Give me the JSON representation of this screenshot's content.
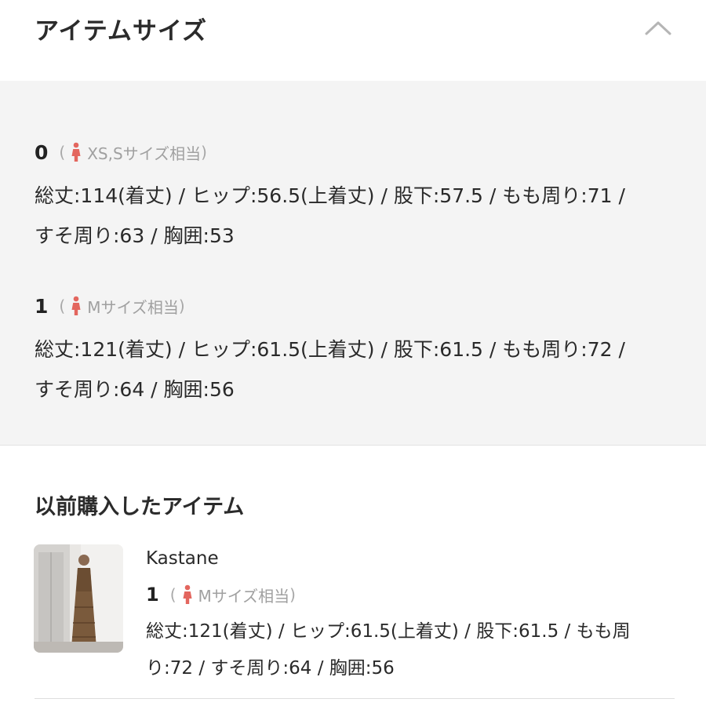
{
  "header": {
    "title": "アイテムサイズ",
    "toggle_icon": "chevron-up-icon"
  },
  "sizes": [
    {
      "number": "0",
      "paren_open": "(",
      "equivalent": "XS,Sサイズ相当",
      "paren_close": ")",
      "measurements": "総丈:114(着丈) / ヒップ:56.5(上着丈) / 股下:57.5 / もも周り:71 / すそ周り:63 / 胸囲:53"
    },
    {
      "number": "1",
      "paren_open": "(",
      "equivalent": "Mサイズ相当",
      "paren_close": ")",
      "measurements": "総丈:121(着丈) / ヒップ:61.5(上着丈) / 股下:61.5 / もも周り:72 / すそ周り:64 / 胸囲:56"
    }
  ],
  "previous": {
    "title": "以前購入したアイテム",
    "item": {
      "brand": "Kastane",
      "number": "1",
      "paren_open": "(",
      "equivalent": "Mサイズ相当",
      "paren_close": ")",
      "measurements": "総丈:121(着丈) / ヒップ:61.5(上着丈) / 股下:61.5 / もも周り:72 / すそ周り:64 / 胸囲:56"
    }
  },
  "colors": {
    "panel_bg": "#f4f4f4",
    "person_icon": "#e3665e",
    "muted_text": "#a0a0a0"
  },
  "icons": {
    "person": "female-person-icon",
    "thumbnail": "product-thumbnail"
  }
}
